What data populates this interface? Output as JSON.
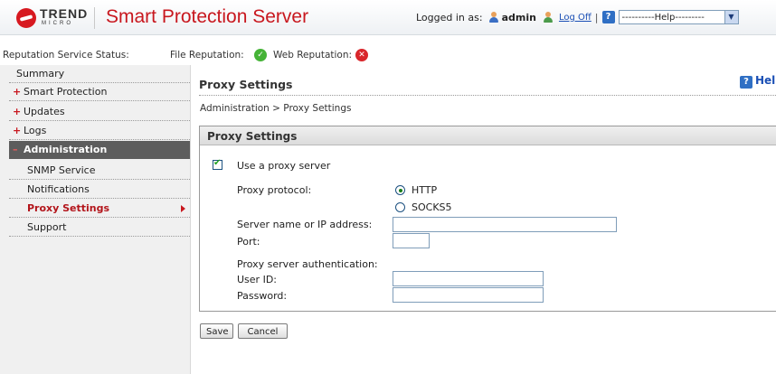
{
  "header": {
    "brand_word": "TREND",
    "brand_sub": "MICRO",
    "app_title": "Smart Protection Server",
    "logged_in_label": "Logged in as:",
    "username": "admin",
    "log_off": "Log Off",
    "separator": "|",
    "help_select": "----------Help---------"
  },
  "status": {
    "label": "Reputation Service Status:",
    "file_reputation": "File Reputation:",
    "web_reputation": "Web Reputation:",
    "file_status": "ok",
    "web_status": "error"
  },
  "sidebar": {
    "items": [
      {
        "label": "Summary"
      },
      {
        "label": "Smart Protection",
        "prefix": "+"
      },
      {
        "label": "Updates",
        "prefix": "+"
      },
      {
        "label": "Logs",
        "prefix": "+"
      },
      {
        "label": "Administration",
        "prefix": "–"
      }
    ],
    "sub_items": [
      {
        "label": "SNMP Service"
      },
      {
        "label": "Notifications"
      },
      {
        "label": "Proxy Settings"
      },
      {
        "label": "Support"
      }
    ]
  },
  "main": {
    "page_title": "Proxy Settings",
    "help_label": "Help",
    "breadcrumb": "Administration > Proxy Settings",
    "panel_title": "Proxy Settings",
    "use_proxy_label": "Use a proxy server",
    "use_proxy_checked": true,
    "protocol_label": "Proxy protocol:",
    "protocol_options": [
      "HTTP",
      "SOCKS5"
    ],
    "protocol_selected": "HTTP",
    "server_label": "Server name or IP address:",
    "server_value": "",
    "port_label": "Port:",
    "port_value": "",
    "auth_label": "Proxy server authentication:",
    "userid_label": "User ID:",
    "userid_value": "",
    "password_label": "Password:",
    "password_value": ""
  },
  "buttons": {
    "save": "Save",
    "cancel": "Cancel"
  },
  "colors": {
    "brand_red": "#c8171e",
    "link_blue": "#1a4fb5",
    "nav_active_bg": "#5d5d5d",
    "status_ok": "#45b337",
    "status_error": "#d9262b"
  }
}
